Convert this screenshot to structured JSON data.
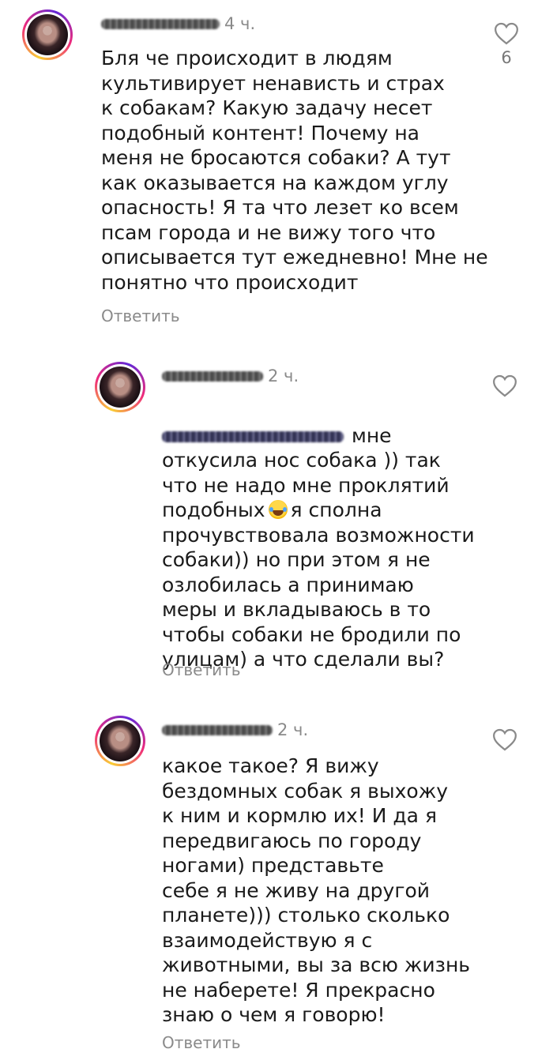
{
  "comments": [
    {
      "username": "nstorjvolkt",
      "time": "4 ч.",
      "text": "Бля че происходит в людям\nкультивирует ненависть и страх\nк собакам? Какую задачу несет\nподобный контент! Почему на\nменя не бросаются собаки? А тут\nкак оказывается на каждом углу\nопасность! Я та что лезет ко всем\nпсам города и не вижу того что\nописывается тут ежедневно! Мне не\nпонятно что происходит",
      "reply_label": "Ответить",
      "likes": "6",
      "like_icon": "heart-outline-icon"
    },
    {
      "username": "vikrtoryvod",
      "time": "2 ч.",
      "mention": "@marichka_02_01_08",
      "text_after_mention": "мне",
      "text": "откусила нос собака )) так\nчто не надо мне проклятий\nподобных",
      "emoji": "face-with-tears-of-joy-icon",
      "text_after_emoji": "я сполна\nпрочувствовала возможности\nсобаки)) но при этом я не\nозлобилась а принимаю\nмеры и вкладываюсь в то\nчтобы собаки не бродили по\nулицам) а что сделали вы?",
      "reply_label": "Ответить",
      "like_icon": "heart-outline-icon"
    },
    {
      "username": "nstorjvolkt",
      "time": "2 ч.",
      "text": "какое такое?  Я вижу\nбездомных собак я выхожу\nк ним и кормлю их! И да я\nпередвигаюсь по городу\nногами) представьте\nсебе я не живу на другой\nпланете))) столько сколько\nвзаимодействую я с\nживотными, вы за всю жизнь\nне наберете! Я прекрасно\nзнаю о чем я говорю!",
      "reply_label": "Ответить",
      "like_icon": "heart-outline-icon"
    }
  ]
}
